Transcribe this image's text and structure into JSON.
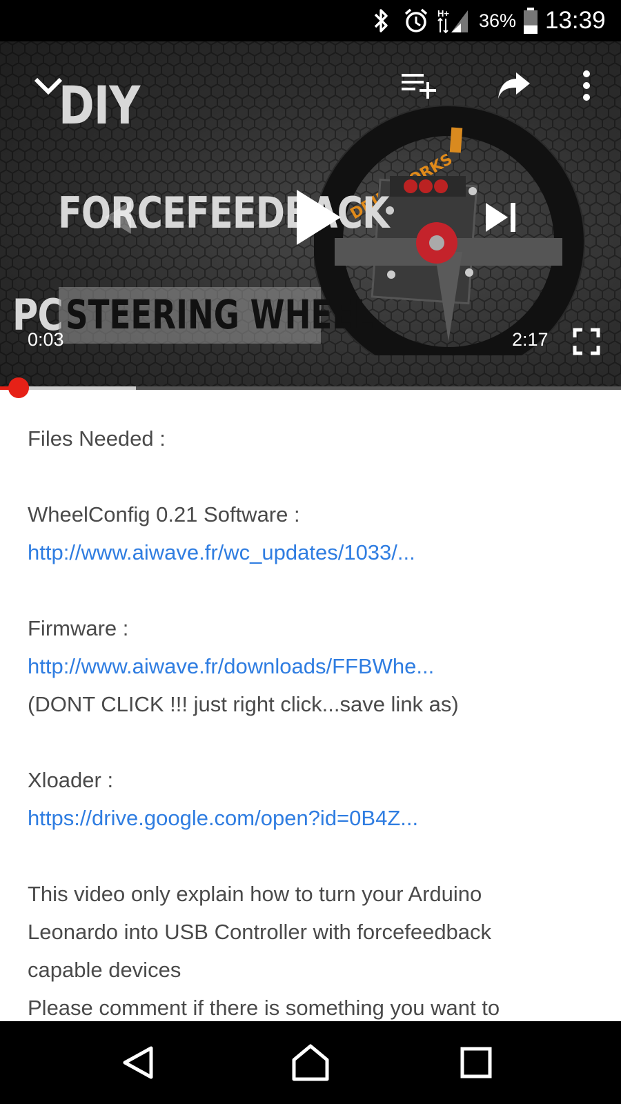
{
  "status_bar": {
    "battery_percent": "36%",
    "battery_level": 0.36,
    "time": "13:39",
    "network_label": "H+",
    "icons": [
      "bluetooth-icon",
      "alarm-icon",
      "signal-icon",
      "battery-icon"
    ]
  },
  "video": {
    "overlay_title": {
      "line1": "DIY",
      "line2": "FORCEFEEDBACK",
      "line3_prefix": "PC",
      "line3_box": "STEERING WHEEL",
      "wheel_brand": "DRIFTWORKS"
    },
    "current_time": "0:03",
    "duration": "2:17",
    "progress_played": 0.022,
    "progress_buffered": 0.219,
    "icons": [
      "collapse-icon",
      "add-to-playlist-icon",
      "share-icon",
      "more-icon",
      "previous-icon",
      "play-icon",
      "next-icon",
      "fullscreen-icon"
    ]
  },
  "description": {
    "files_heading": "Files Needed :",
    "wheelconfig_label": "WheelConfig 0.21 Software :",
    "wheelconfig_link": "http://www.aiwave.fr/wc_updates/1033/...",
    "firmware_label": "Firmware :",
    "firmware_link": "http://www.aiwave.fr/downloads/FFBWhe...",
    "firmware_note": "(DONT CLICK !!! just right click...save link as)",
    "xloader_label": "Xloader :",
    "xloader_link": "https://drive.google.com/open?id=0B4Z...",
    "para_line1": "This video only explain how to turn your Arduino",
    "para_line2": "Leonardo into USB Controller with forcefeedback",
    "para_line3": "capable devices",
    "para_line4": "Please comment if there is something you want to"
  },
  "colors": {
    "accent_red": "#e62117",
    "link_blue": "#2f7de1",
    "text_gray": "#4a4a4a"
  },
  "nav_bar": {
    "icons": [
      "back-icon",
      "home-icon",
      "recents-icon"
    ]
  }
}
